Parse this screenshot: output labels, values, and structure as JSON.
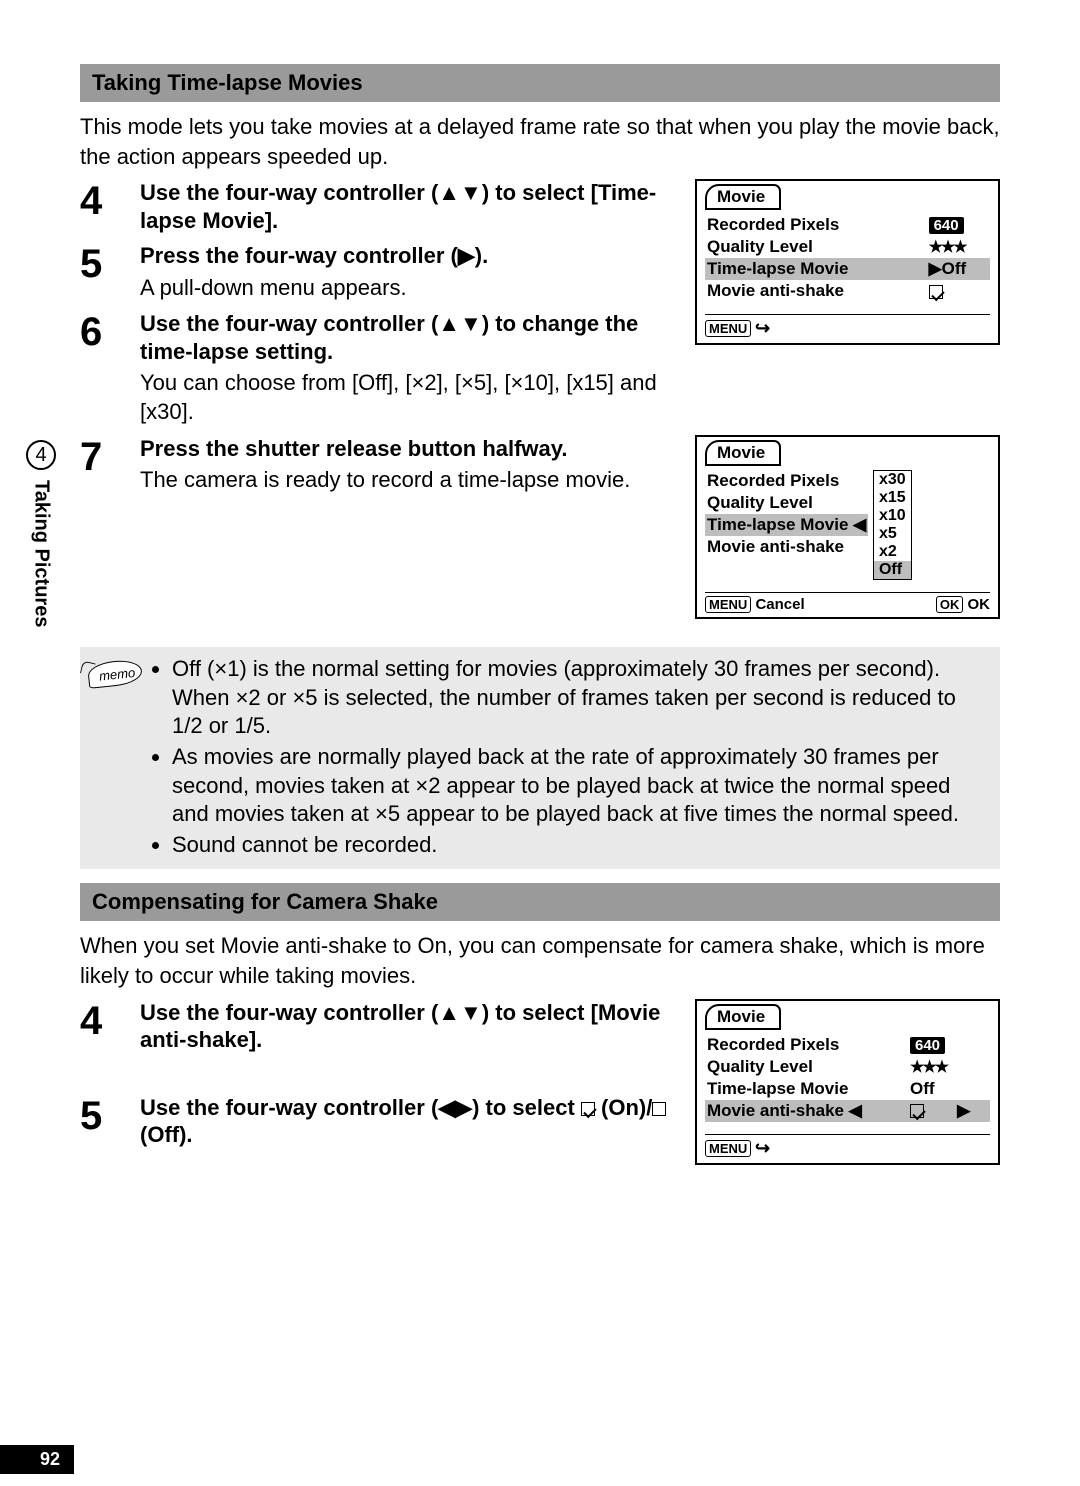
{
  "side_tab": {
    "chapter_num": "4",
    "chapter_title": "Taking Pictures"
  },
  "page_number": "92",
  "section1": {
    "title": "Taking Time-lapse Movies",
    "intro": "This mode lets you take movies at a delayed frame rate so that when you play the movie back, the action appears speeded up.",
    "steps": {
      "s4": {
        "num": "4",
        "title": "Use the four-way controller (▲▼) to select [Time-lapse Movie]."
      },
      "s5": {
        "num": "5",
        "title": "Press the four-way controller (▶).",
        "desc": "A pull-down menu appears."
      },
      "s6": {
        "num": "6",
        "title": "Use the four-way controller (▲▼) to change the time-lapse setting.",
        "desc": "You can choose from [Off], [×2], [×5], [×10], [x15] and [x30]."
      },
      "s7": {
        "num": "7",
        "title": "Press the shutter release button halfway.",
        "desc": "The camera is ready to record a time-lapse movie."
      }
    },
    "screen1": {
      "tab": "Movie",
      "rows": {
        "rp": {
          "label": "Recorded Pixels",
          "val": "640"
        },
        "ql": {
          "label": "Quality Level",
          "val": "★★★"
        },
        "tl": {
          "label": "Time-lapse Movie",
          "val": "Off"
        },
        "mas": {
          "label": "Movie anti-shake"
        }
      },
      "menu_key": "MENU"
    },
    "screen2": {
      "tab": "Movie",
      "rows": {
        "rp": "Recorded Pixels",
        "ql": "Quality Level",
        "tl": "Time-lapse Movie",
        "mas": "Movie anti-shake"
      },
      "options": [
        "x30",
        "x15",
        "x10",
        "x5",
        "x2",
        "Off"
      ],
      "menu_key": "MENU",
      "menu_label": "Cancel",
      "ok_key": "OK",
      "ok_label": "OK"
    },
    "memo": {
      "label": "memo",
      "items": [
        "Off (×1) is the normal setting for movies (approximately 30 frames per second). When ×2 or ×5 is selected, the number of frames taken per second is reduced to 1/2 or 1/5.",
        "As movies are normally played back at the rate of approximately 30 frames per second, movies taken at ×2 appear to be played back at twice the normal speed and movies taken at ×5 appear to be played back at five times the normal speed.",
        "Sound cannot be recorded."
      ]
    }
  },
  "section2": {
    "title": "Compensating for Camera Shake",
    "intro": "When you set Movie anti-shake to On, you can compensate for camera shake, which is more likely to occur while taking movies.",
    "steps": {
      "s4": {
        "num": "4",
        "title": "Use the four-way controller (▲▼) to select [Movie anti-shake]."
      },
      "s5": {
        "num": "5",
        "title_pre": "Use the four-way controller (◀▶) to select ",
        "on": " (On)/",
        "off": " (Off)."
      }
    },
    "screen": {
      "tab": "Movie",
      "rows": {
        "rp": {
          "label": "Recorded Pixels",
          "val": "640"
        },
        "ql": {
          "label": "Quality Level",
          "val": "★★★"
        },
        "tl": {
          "label": "Time-lapse Movie",
          "val": "Off"
        },
        "mas": {
          "label": "Movie anti-shake"
        }
      },
      "menu_key": "MENU"
    }
  }
}
